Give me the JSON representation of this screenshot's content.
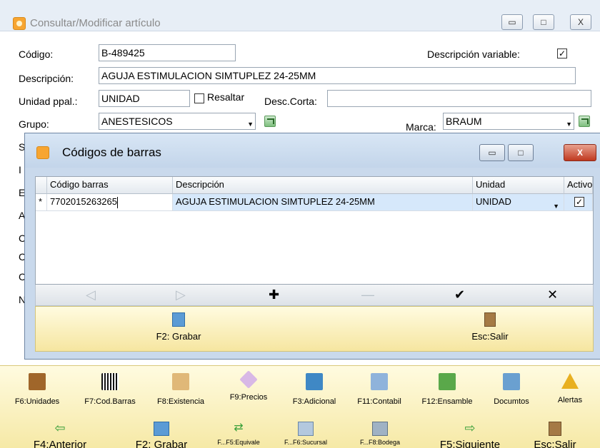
{
  "main": {
    "title": "Consultar/Modificar artículo",
    "win_buttons": [
      "▭",
      "□",
      "X"
    ],
    "labels": {
      "codigo": "Código:",
      "descripcion": "Descripción:",
      "unidad": "Unidad ppal.:",
      "grupo": "Grupo:",
      "desc_variable": "Descripción variable:",
      "resaltar": "Resaltar",
      "desc_corta": "Desc.Corta:",
      "marca": "Marca:"
    },
    "values": {
      "codigo": "B-489425",
      "descripcion": "AGUJA ESTIMULACION SIMTUPLEZ 24-25MM",
      "unidad": "UNIDAD",
      "grupo": "ANESTESICOS",
      "marca": "BRAUM",
      "desc_corta": ""
    },
    "desc_variable_checked": "✓",
    "resaltar_checked": "",
    "partial_labels": [
      "S",
      "I",
      "E",
      "A",
      "C",
      "C",
      "C",
      "N"
    ]
  },
  "dialog": {
    "title": "Códigos de barras",
    "buttons": [
      "▭",
      "□",
      "X"
    ],
    "columns": [
      "Código barras",
      "Descripción",
      "Unidad",
      "Activo"
    ],
    "rows": [
      {
        "marker": "*",
        "codigo": "7702015263265",
        "descripcion": "AGUJA ESTIMULACION SIMTUPLEZ 24-25MM",
        "unidad": "UNIDAD",
        "activo": "✓"
      }
    ],
    "nav": {
      "prev": "◁",
      "next": "▷",
      "add": "✚",
      "remove": "—",
      "accept": "✔",
      "cancel": "✕"
    },
    "actions": {
      "save": "F2: Grabar",
      "exit": "Esc:Salir"
    }
  },
  "toolbar": {
    "row1": [
      {
        "label": "F6:Unidades",
        "icon": "box-icon",
        "color": "#a0662a"
      },
      {
        "label": "F7:Cod.Barras",
        "icon": "barcode-icon",
        "color": "#222222"
      },
      {
        "label": "F8:Existencia",
        "icon": "clipboard-icon",
        "color": "#e0b878"
      },
      {
        "label": "F9:Precios",
        "icon": "tag-icon",
        "color": "#c8a0d8"
      },
      {
        "label": "F3:Adicional",
        "icon": "window-icon",
        "color": "#3f88c5"
      },
      {
        "label": "F11:Contabil",
        "icon": "sheet-icon",
        "color": "#8fb3db"
      },
      {
        "label": "F12:Ensamble",
        "icon": "puzzle-icon",
        "color": "#5aa84a"
      },
      {
        "label": "Documtos",
        "icon": "document-icon",
        "color": "#6aa0d0"
      },
      {
        "label": "Alertas",
        "icon": "warning-icon",
        "color": "#e8b020"
      }
    ],
    "row2": [
      {
        "label": "F4:Anterior",
        "icon": "arrow-left-icon"
      },
      {
        "label": "F2: Grabar",
        "icon": "save-icon"
      },
      {
        "label": "F...F5:Equivale",
        "icon": "shuffle-icon"
      },
      {
        "label": "F...F6:Sucursal",
        "icon": "branches-icon"
      },
      {
        "label": "F...F8:Bodega",
        "icon": "warehouse-icon"
      },
      {
        "label": "F5:Siguiente",
        "icon": "arrow-right-icon"
      },
      {
        "label": "Esc:Salir",
        "icon": "door-icon"
      }
    ]
  }
}
